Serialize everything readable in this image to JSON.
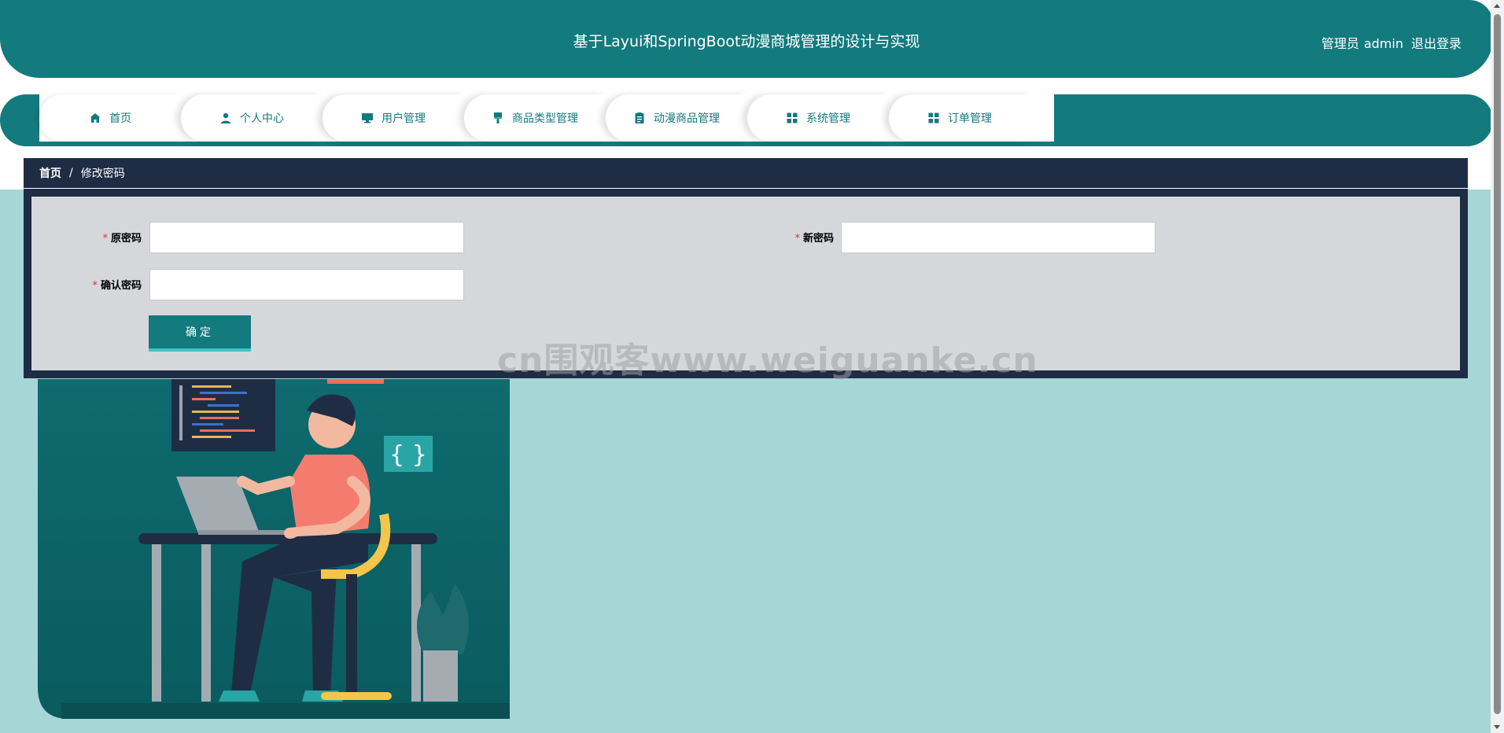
{
  "header": {
    "title": "基于Layui和SpringBoot动漫商城管理的设计与实现",
    "role": "管理员",
    "username": "admin",
    "logout": "退出登录"
  },
  "nav": {
    "items": [
      {
        "label": "首页",
        "icon": "home-icon"
      },
      {
        "label": "个人中心",
        "icon": "user-icon"
      },
      {
        "label": "用户管理",
        "icon": "monitor-icon"
      },
      {
        "label": "商品类型管理",
        "icon": "brush-icon"
      },
      {
        "label": "动漫商品管理",
        "icon": "clipboard-icon"
      },
      {
        "label": "系统管理",
        "icon": "grid-icon"
      },
      {
        "label": "订单管理",
        "icon": "grid-icon"
      }
    ]
  },
  "breadcrumb": {
    "home": "首页",
    "separator": "/",
    "current": "修改密码"
  },
  "form": {
    "old_password_label": "原密码",
    "new_password_label": "新密码",
    "confirm_password_label": "确认密码",
    "required_mark": "*",
    "old_password_value": "",
    "new_password_value": "",
    "confirm_password_value": "",
    "submit_label": "确定"
  },
  "watermark": "cn围观客www.weiguanke.cn",
  "colors": {
    "primary": "#137a7d",
    "dark_panel": "#1f2d44",
    "form_bg": "#d5d7db",
    "page_bg": "#a7d6d7",
    "required": "#e2322d"
  }
}
